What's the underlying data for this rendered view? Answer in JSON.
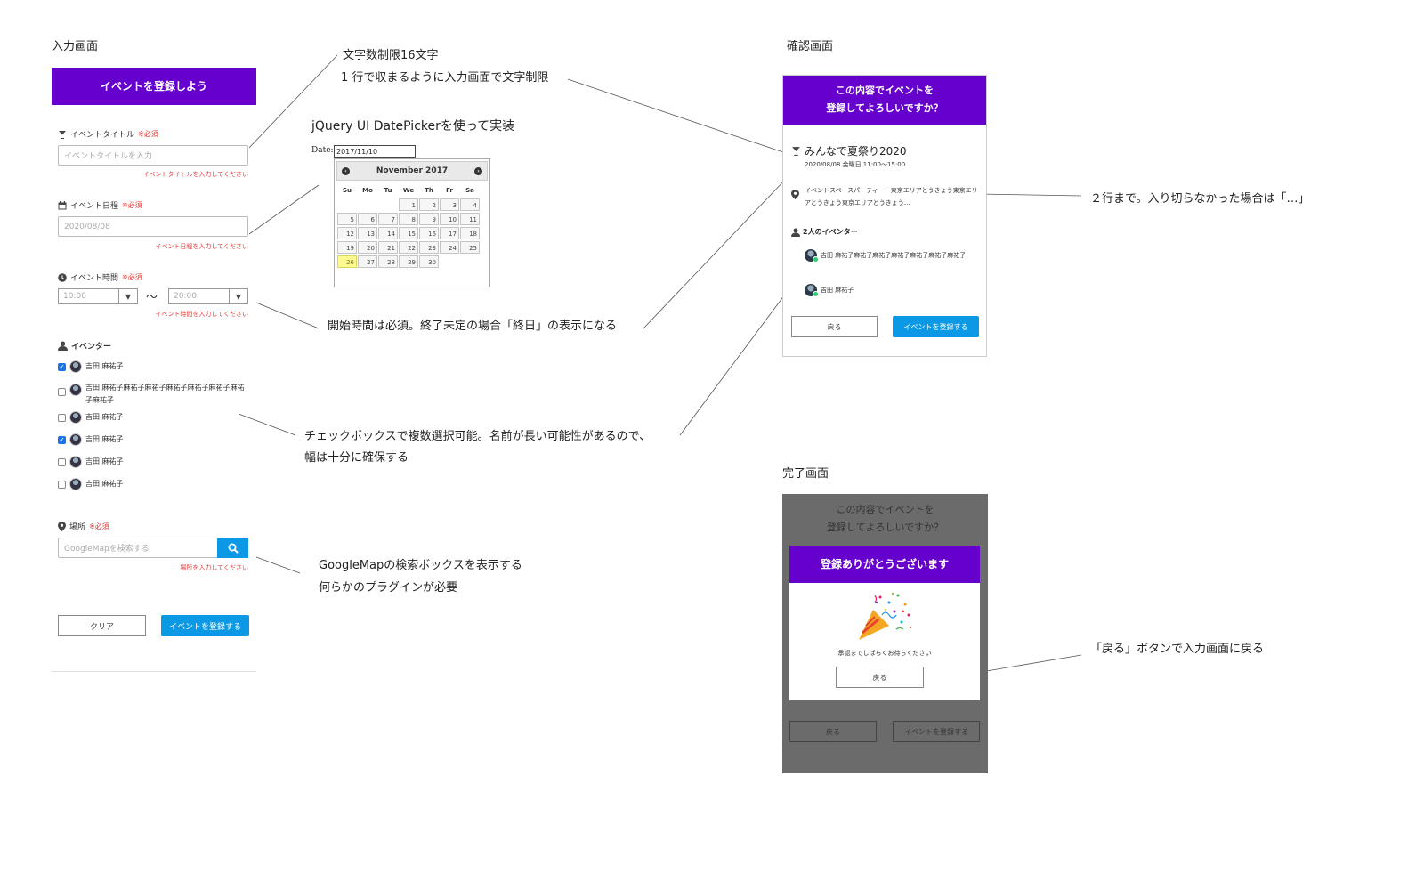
{
  "input_screen": {
    "section_title": "入力画面",
    "header": "イベントを登録しよう",
    "title_field": {
      "label": "イベントタイトル",
      "required": "※必須",
      "placeholder": "イベントタイトルを入力",
      "error": "イベントタイトルを入力してください"
    },
    "date_field": {
      "label": "イベント日程",
      "required": "※必須",
      "value": "2020/08/08",
      "error": "イベント日程を入力してください"
    },
    "time_field": {
      "label": "イベント時間",
      "required": "※必須",
      "start": "10:00",
      "end": "20:00",
      "separator": "〜",
      "error": "イベント時間を入力してください"
    },
    "inventer_label": "イベンター",
    "inventers": [
      {
        "name": "吉田 麻祐子",
        "checked": true
      },
      {
        "name": "吉田 麻祐子麻祐子麻祐子麻祐子麻祐子麻祐子麻祐子麻祐子",
        "checked": false
      },
      {
        "name": "吉田 麻祐子",
        "checked": false
      },
      {
        "name": "吉田 麻祐子",
        "checked": true
      },
      {
        "name": "吉田 麻祐子",
        "checked": false
      },
      {
        "name": "吉田 麻祐子",
        "checked": false
      }
    ],
    "place_field": {
      "label": "場所",
      "required": "※必須",
      "placeholder": "GoogleMapを検索する",
      "error": "場所を入力してください"
    },
    "clear_button": "クリア",
    "submit_button": "イベントを登録する"
  },
  "datepicker": {
    "title": "jQuery UI DatePickerを使って実装",
    "date_label": "Date:",
    "date_value": "2017/11/10",
    "month": "November 2017",
    "prev_icon": "‹",
    "next_icon": "›",
    "dow": [
      "Su",
      "Mo",
      "Tu",
      "We",
      "Th",
      "Fr",
      "Sa"
    ],
    "first_weekday": 3,
    "days": 30,
    "today": 26
  },
  "notes": {
    "title_limit_1": "文字数制限16文字",
    "title_limit_2": "1 行で収まるように入力画面で文字制限",
    "time_note": "開始時間は必須。終了未定の場合「終日」の表示になる",
    "checkbox_note_1": "チェックボックスで複数選択可能。名前が長い可能性があるので、",
    "checkbox_note_2": "幅は十分に確保する",
    "map_note_1": "GoogleMapの検索ボックスを表示する",
    "map_note_2": "何らかのプラグインが必要",
    "place_note": "２行まで。入り切らなかった場合は「…」",
    "back_note": "「戻る」ボタンで入力画面に戻る"
  },
  "confirm_screen": {
    "section_title": "確認画面",
    "header_line1": "この内容でイベントを",
    "header_line2": "登録してよろしいですか？",
    "event_title": "みんなで夏祭り2020",
    "event_datetime": "2020/08/08 金曜日 11:00〜15:00",
    "place": "イベントスペースパーティー　東京エリアとうきょう東京エリアとうきょう東京エリアとうきょう…",
    "inventer_count": "2人のイベンター",
    "inventers": [
      "吉田 麻祐子麻祐子麻祐子麻祐子麻祐子麻祐子麻祐子",
      "吉田 麻祐子"
    ],
    "back_button": "戻る",
    "submit_button": "イベントを登録する"
  },
  "done_screen": {
    "section_title": "完了画面",
    "bg_header_line1": "この内容でイベントを",
    "bg_header_line2": "登録してよろしいですか？",
    "modal_header": "登録ありがとうございます",
    "message": "承認までしばらくお待ちください",
    "back_button": "戻る",
    "bg_back_button": "戻る",
    "bg_submit_button": "イベントを登録する"
  },
  "colors": {
    "accent": "#6600cc",
    "primary_button": "#0b99e6",
    "error": "#e53935",
    "overlay": "#6b6b6b"
  }
}
